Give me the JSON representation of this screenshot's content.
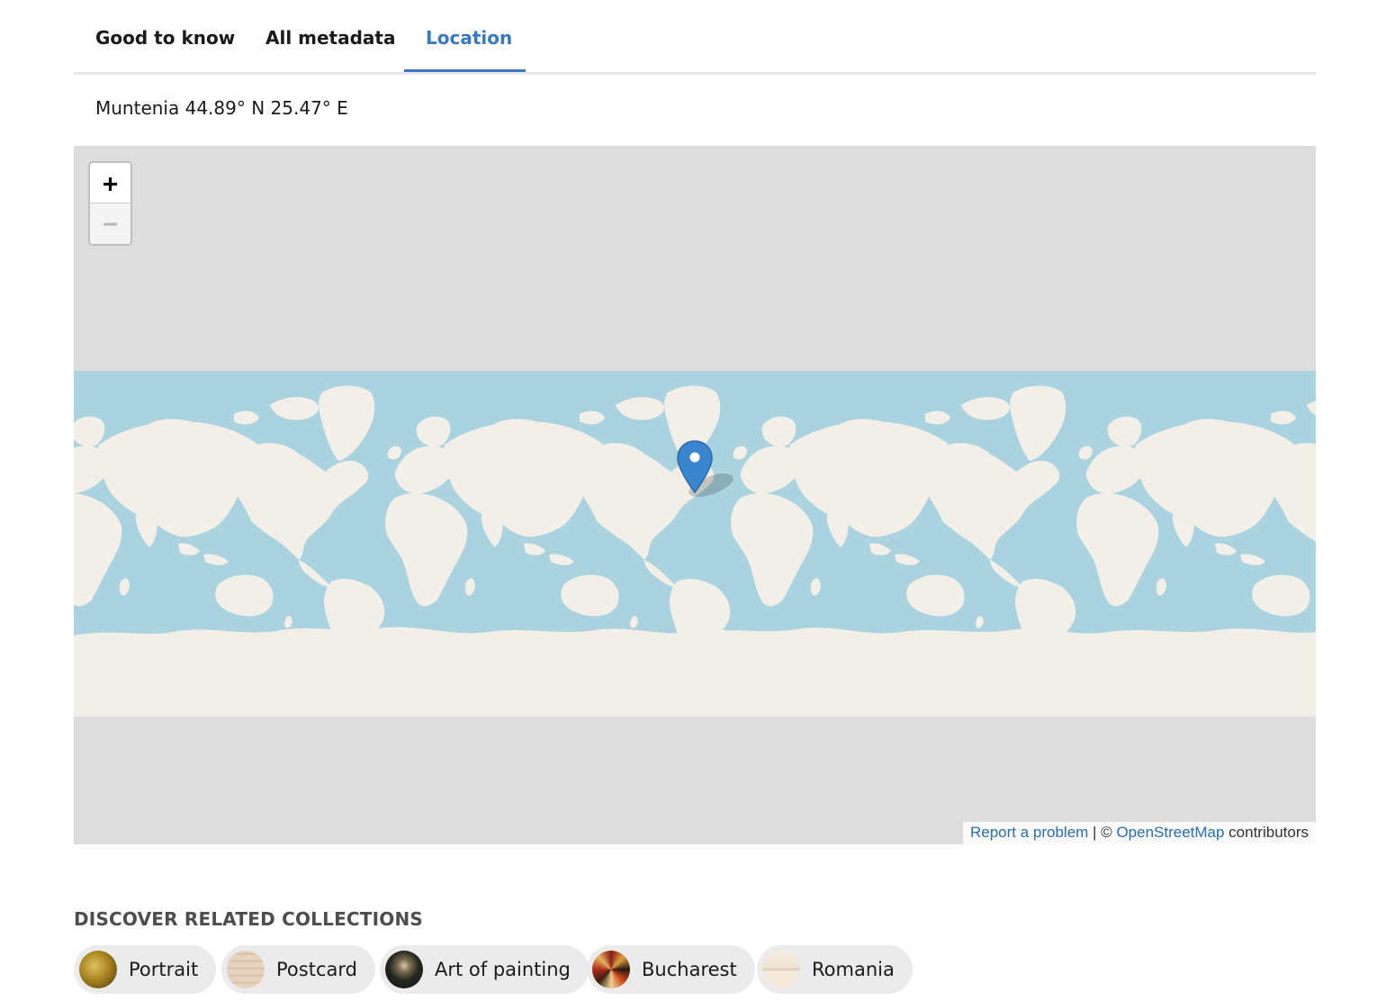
{
  "tabs": [
    {
      "label": "Good to know",
      "active": false
    },
    {
      "label": "All metadata",
      "active": false
    },
    {
      "label": "Location",
      "active": true
    }
  ],
  "location": {
    "text": "Muntenia 44.89° N 25.47° E"
  },
  "map": {
    "zoom_in_symbol": "+",
    "zoom_out_symbol": "−",
    "marker_icon": "map-pin-icon",
    "attribution": {
      "report_link": "Report a problem",
      "separator": " | © ",
      "osm_link": "OpenStreetMap",
      "suffix": " contributors"
    },
    "colors": {
      "background": "#dddddd",
      "ocean": "#aad3df",
      "land": "#f2efe9",
      "marker": "#3a85d0"
    }
  },
  "related": {
    "heading": "DISCOVER RELATED COLLECTIONS",
    "collections": [
      {
        "label": "Portrait"
      },
      {
        "label": "Postcard"
      },
      {
        "label": "Art of painting"
      },
      {
        "label": "Bucharest"
      },
      {
        "label": "Romania"
      }
    ]
  },
  "colors": {
    "accent": "#3a78c3",
    "link": "#2a6eac",
    "chip_background": "#ebebeb"
  }
}
